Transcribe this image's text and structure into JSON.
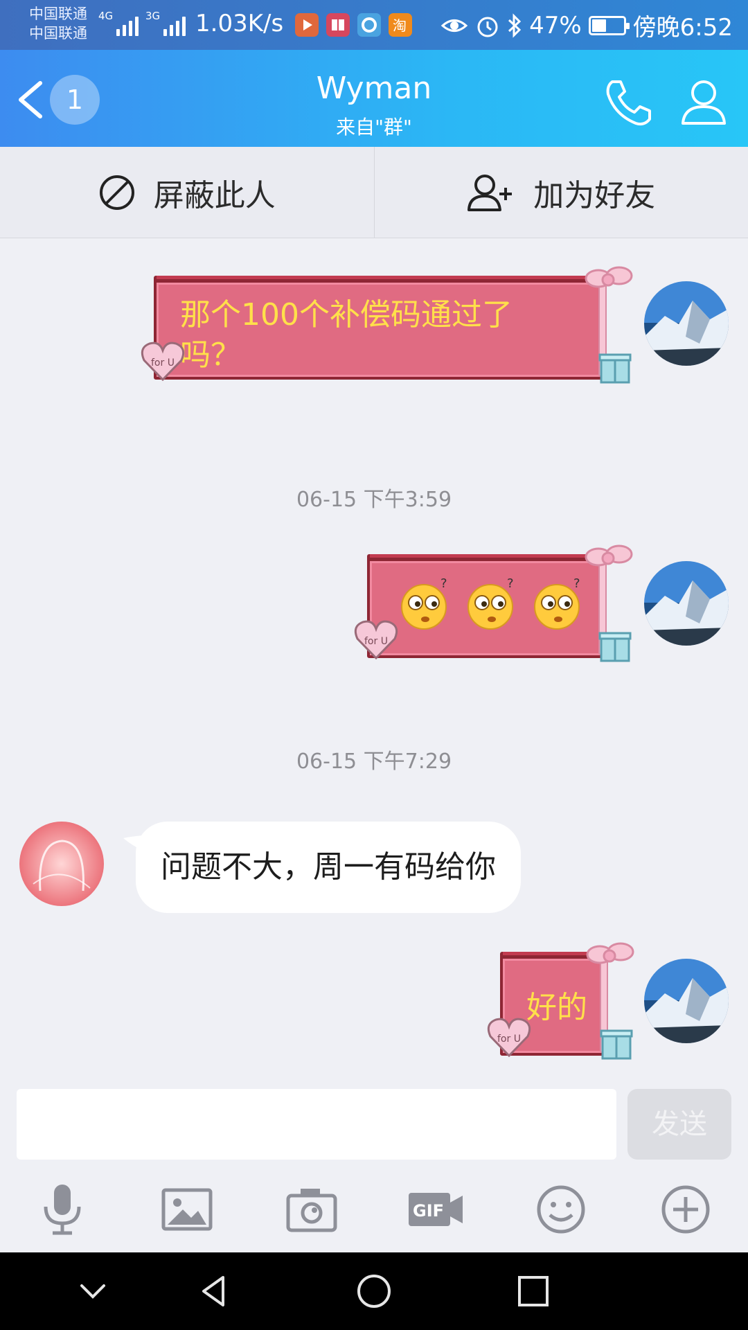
{
  "status_bar": {
    "carrier_1": "中国联通",
    "carrier_2": "中国联通",
    "network_1": "4G",
    "network_2": "3G",
    "speed": "1.03K/s",
    "app_icons": [
      "video-app-icon",
      "reader-app-icon",
      "browser-app-icon",
      "taobao-app-icon"
    ],
    "battery": "47%",
    "battery_level": 0.47,
    "time": "傍晚6:52"
  },
  "header": {
    "back_badge": "1",
    "title": "Wyman",
    "subtitle": "来自\"群\""
  },
  "actions": {
    "block_label": "屏蔽此人",
    "add_friend_label": "加为好友"
  },
  "messages": [
    {
      "side": "right",
      "style": "gift",
      "text_line_1": "那个100个补偿码通过了",
      "text_line_2": "吗？"
    },
    {
      "type": "timestamp",
      "text": "06-15 下午3:59"
    },
    {
      "side": "right",
      "style": "gift",
      "emoji": [
        "confused-emoji",
        "confused-emoji",
        "confused-emoji"
      ]
    },
    {
      "type": "timestamp",
      "text": "06-15 下午7:29"
    },
    {
      "side": "left",
      "style": "bubble",
      "text": "问题不大，周一有码给你"
    },
    {
      "side": "right",
      "style": "gift",
      "text": "好的"
    }
  ],
  "composer": {
    "input_value": "",
    "send_label": "发送"
  },
  "colors": {
    "header_start": "#3d8cf0",
    "header_end": "#28c6f7",
    "gift_fill": "#e06b82",
    "gift_text": "#ffe04a",
    "page_bg": "#eff0f5"
  }
}
